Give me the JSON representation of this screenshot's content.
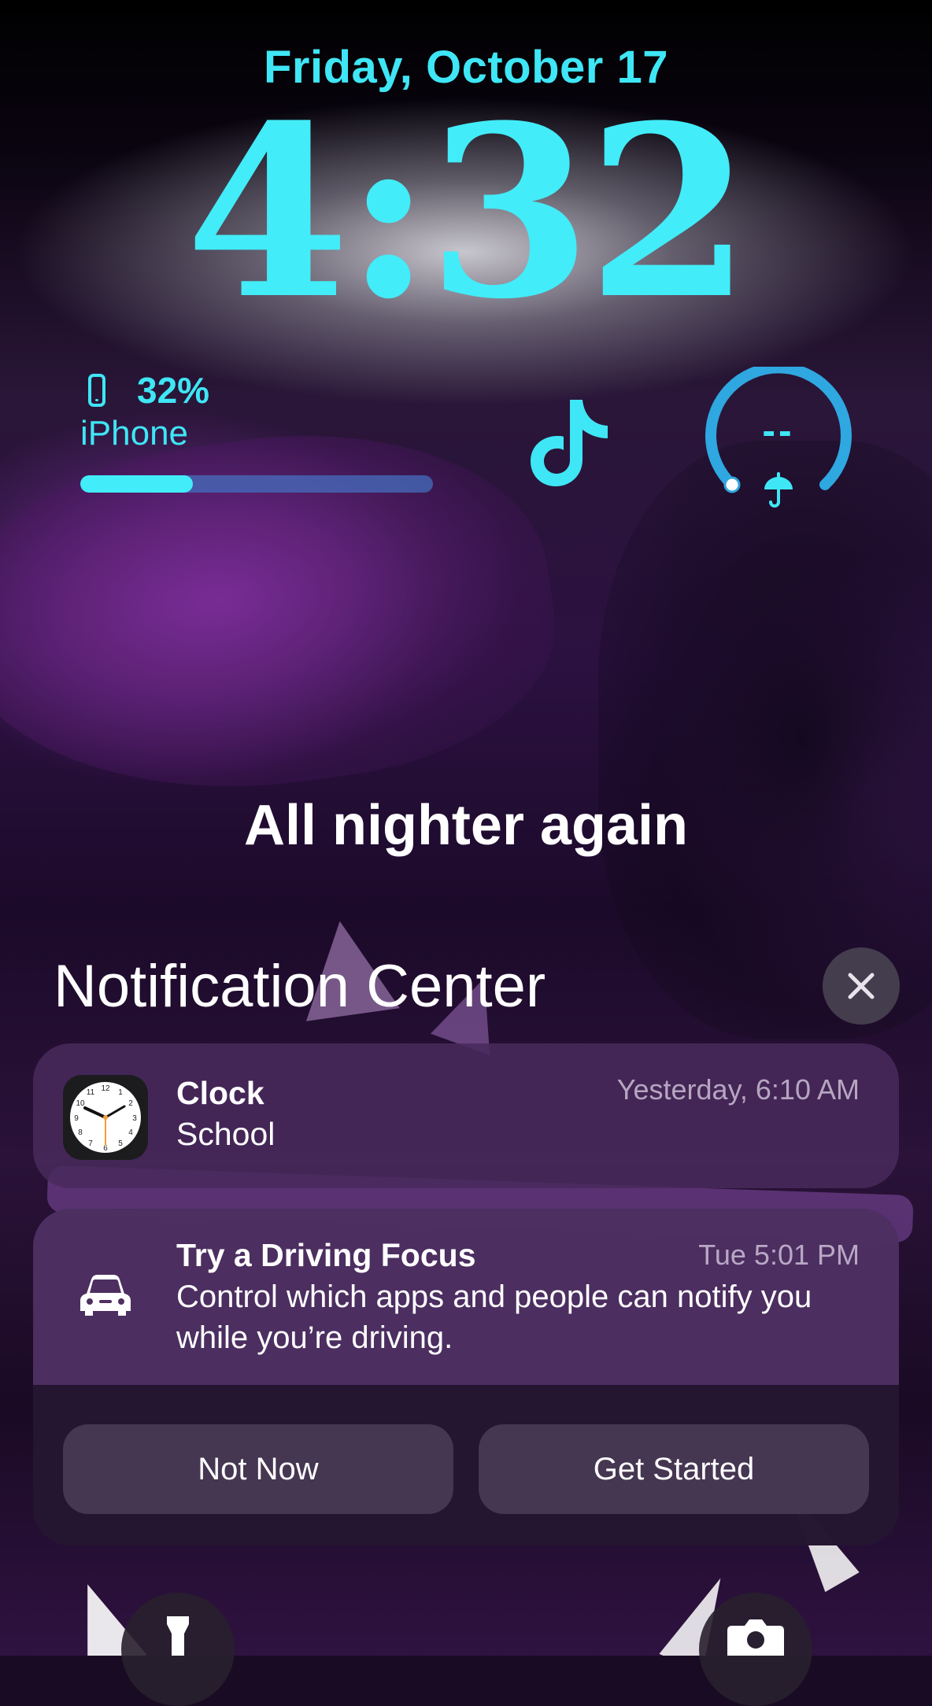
{
  "lockscreen": {
    "date": "Friday, October 17",
    "time": "4:32",
    "caption": "All nighter again"
  },
  "widgets": {
    "battery": {
      "percent_label": "32%",
      "device_name": "iPhone",
      "level": 0.32,
      "icon": "iphone-icon"
    },
    "tiktok": {
      "icon": "tiktok-icon"
    },
    "weather_gauge": {
      "value": "--",
      "icon": "umbrella-icon"
    }
  },
  "notification_center": {
    "title": "Notification Center",
    "close_icon": "close-icon",
    "notifications": [
      {
        "app": "Clock",
        "body": "School",
        "time": "Yesterday, 6:10 AM",
        "icon": "clock-app-icon"
      },
      {
        "app": "Try a Driving Focus",
        "body": "Control which apps and people can notify you while you’re driving.",
        "time": "Tue 5:01 PM",
        "icon": "car-icon",
        "actions": [
          "Not Now",
          "Get Started"
        ]
      }
    ]
  },
  "quick_actions": {
    "left_icon": "flashlight-icon",
    "right_icon": "camera-icon"
  },
  "colors": {
    "accent": "#42ecf8",
    "gauge": "#2fa7e0",
    "card": "#482a5c"
  }
}
